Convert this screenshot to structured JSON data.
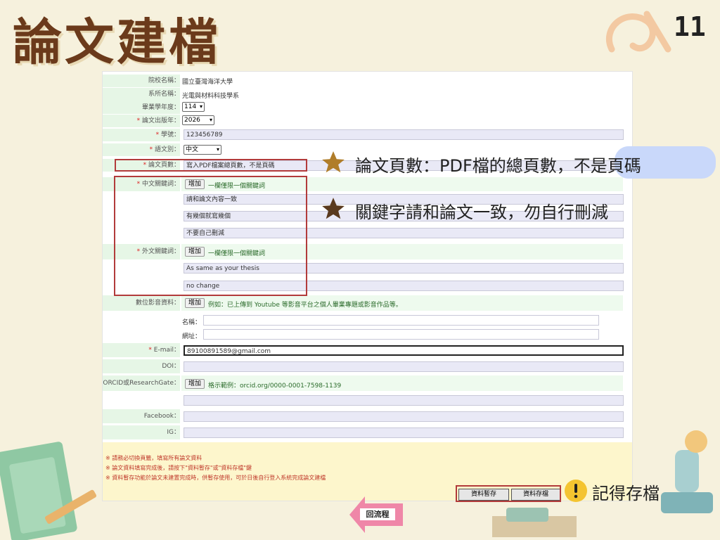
{
  "slide": {
    "title": "論文建檔",
    "page": "11"
  },
  "form": {
    "school_label": "院校名稱：",
    "school_value": "國立臺灣海洋大學",
    "dept_label": "系所名稱：",
    "dept_value": "光電與材料科技學系",
    "grad_year_label": "畢業學年度：",
    "grad_year_value": "114",
    "pub_year_label": "論文出版年：",
    "pub_year_value": "2026",
    "student_id_label": "學號：",
    "student_id_value": "123456789",
    "language_label": "語文別：",
    "language_value": "中文",
    "pages_label": "論文頁數：",
    "pages_value": "寫入PDF檔案總頁數，不是頁碼",
    "zh_kw_label": "中文關鍵詞：",
    "zh_kw_add": "增加",
    "zh_kw_hint": "一欄僅限一個關鍵詞",
    "zh_keywords": [
      "請和論文內容一致",
      "有幾個就寫幾個",
      "不要自己刪減"
    ],
    "en_kw_label": "外文關鍵詞：",
    "en_kw_add": "增加",
    "en_kw_hint": "一欄僅限一個關鍵詞",
    "en_keywords": [
      "As same as your thesis",
      "no change"
    ],
    "media_label": "數位影音資料：",
    "media_add": "增加",
    "media_hint": "例如：已上傳到 Youtube 等影音平台之個人畢業專題或影音作品等。",
    "media_name_label": "名稱：",
    "media_url_label": "網址：",
    "email_label": "E-mail：",
    "email_value": "89100891589@gmail.com",
    "doi_label": "DOI：",
    "orcid_label": "ORCID或ResearchGate：",
    "orcid_add": "增加",
    "orcid_hint": "格示範例：orcid.org/0000-0001-7598-1139",
    "facebook_label": "Facebook：",
    "ig_label": "IG：",
    "notes": [
      "※ 請務必切換頁籤，填寫所有論文資料",
      "※ 論文資料填寫完成後，請按下\"資料暫存\"或\"資料存檔\"鍵",
      "※ 資料暫存功能於論文未建置完成時，供暫存使用，可於日後自行登入系統完成論文建檔"
    ],
    "save_temp_label": "資料暫存",
    "save_label": "資料存檔"
  },
  "callouts": {
    "pages_note_a": "論文頁數：PDF檔的總頁數，",
    "pages_note_b": "不是頁碼",
    "keyword_note": "關鍵字請和論文一致，勿自行刪減",
    "save_note": "記得存檔",
    "back_label": "回流程"
  },
  "colors": {
    "title": "#6b3a1b",
    "label_bg": "#e6f6e6",
    "red_box": "#b23b3b",
    "notes_bg": "#fdf6cc"
  }
}
